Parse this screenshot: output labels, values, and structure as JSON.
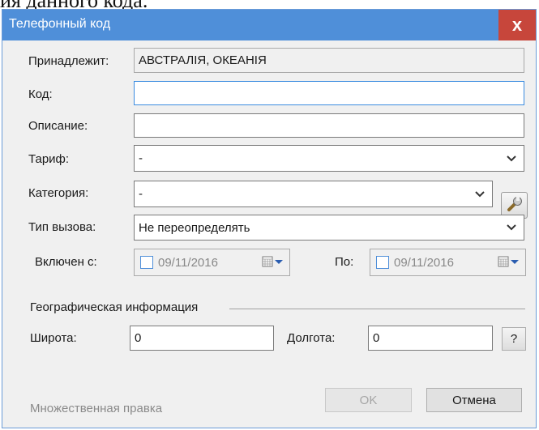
{
  "backdrop": {
    "text": "ия данного кода."
  },
  "dialog": {
    "title": "Телефонный код",
    "close_glyph": "x"
  },
  "form": {
    "owner": {
      "label": "Принадлежит:",
      "value": "АВСТРАЛІЯ, ОКЕАНІЯ"
    },
    "code": {
      "label": "Код:",
      "value": ""
    },
    "description": {
      "label": "Описание:",
      "value": ""
    },
    "tariff": {
      "label": "Тариф:",
      "value": "-"
    },
    "category": {
      "label": "Категория:",
      "value": "-"
    },
    "call_type": {
      "label": "Тип вызова:",
      "value": "Не переопределять"
    },
    "enabled_from": {
      "label": "Включен с:",
      "value": "09/11/2016"
    },
    "to": {
      "label": "По:",
      "value": "09/11/2016"
    }
  },
  "geo": {
    "group_label": "Географическая информация",
    "latitude": {
      "label": "Широта:",
      "value": "0"
    },
    "longitude": {
      "label": "Долгота:",
      "value": "0"
    },
    "help_label": "?"
  },
  "footer": {
    "multi_edit_label": "Множественная правка",
    "ok_label": "OK",
    "cancel_label": "Отмена"
  },
  "icons": {
    "close": "close-icon",
    "dropdown": "chevron-down-icon",
    "wrench": "wrench-icon",
    "calendar": "calendar-icon"
  },
  "colors": {
    "titlebar": "#4f8fd9",
    "close_button": "#c7463b",
    "dialog_bg": "#f0f0f0",
    "focus_border": "#3a8be0"
  }
}
